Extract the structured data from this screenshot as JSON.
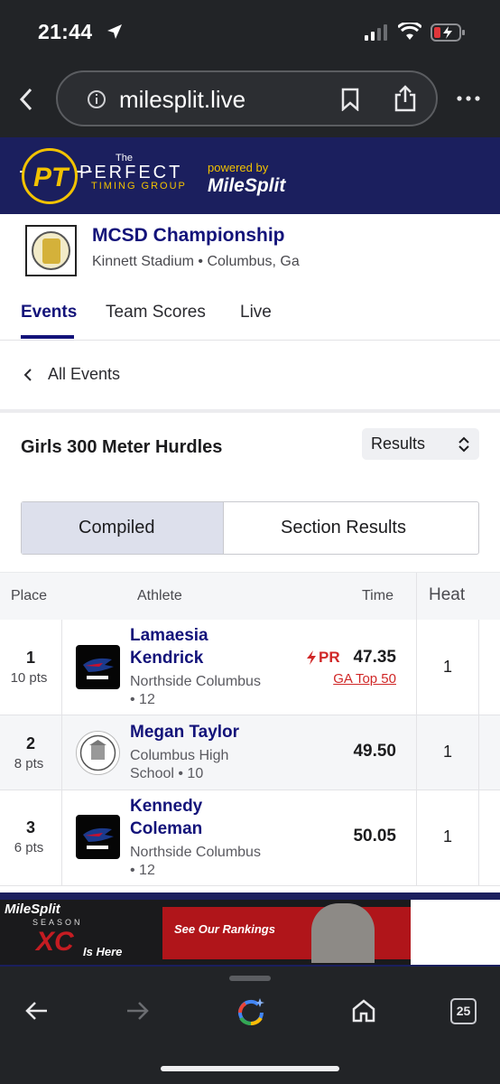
{
  "status": {
    "time": "21:44"
  },
  "browser": {
    "url": "milesplit.live",
    "tab_count": "25"
  },
  "sponsor": {
    "pt_letters": "PT",
    "the": "The",
    "perfect": "PERFECT",
    "timing_group": "TIMING GROUP",
    "powered_by": "powered by",
    "milesplit": "MileSplit"
  },
  "meet": {
    "title": "MCSD Championship",
    "venue": "Kinnett Stadium • Columbus, Ga",
    "tabs": [
      {
        "label": "Events",
        "active": true
      },
      {
        "label": "Team Scores",
        "active": false
      },
      {
        "label": "Live",
        "active": false
      }
    ]
  },
  "nav": {
    "all_events": "All Events"
  },
  "event": {
    "title": "Girls 300 Meter Hurdles",
    "view_select": "Results",
    "segments": [
      "Compiled",
      "Section Results"
    ]
  },
  "table": {
    "headers": {
      "place": "Place",
      "athlete": "Athlete",
      "time": "Time",
      "heat": "Heat"
    },
    "rows": [
      {
        "place": "1",
        "pts": "10 pts",
        "name_line1": "Lamaesia",
        "name_line2": "Kendrick",
        "school_line1": "Northside Columbus",
        "school_line2": "• 12",
        "time": "47.35",
        "pr": "PR",
        "badge": "GA Top 50",
        "heat": "1",
        "team": "patriots"
      },
      {
        "place": "2",
        "pts": "8 pts",
        "name_line1": "Megan Taylor",
        "name_line2": "",
        "school_line1": "Columbus High",
        "school_line2": "School • 10",
        "time": "49.50",
        "pr": "",
        "badge": "",
        "heat": "1",
        "team": "columbus-high"
      },
      {
        "place": "3",
        "pts": "6 pts",
        "name_line1": "Kennedy",
        "name_line2": "Coleman",
        "school_line1": "Northside Columbus",
        "school_line2": "• 12",
        "time": "50.05",
        "pr": "",
        "badge": "",
        "heat": "1",
        "team": "patriots"
      }
    ]
  },
  "ad": {
    "brand": "MileSplit",
    "season": "SEASON",
    "xc": "XC",
    "is_here": "Is Here",
    "cta": "See Our Rankings"
  },
  "colors": {
    "navy": "#13137a",
    "banner": "#1b1f5e",
    "accent_red": "#d02727",
    "gold": "#f2c200"
  }
}
